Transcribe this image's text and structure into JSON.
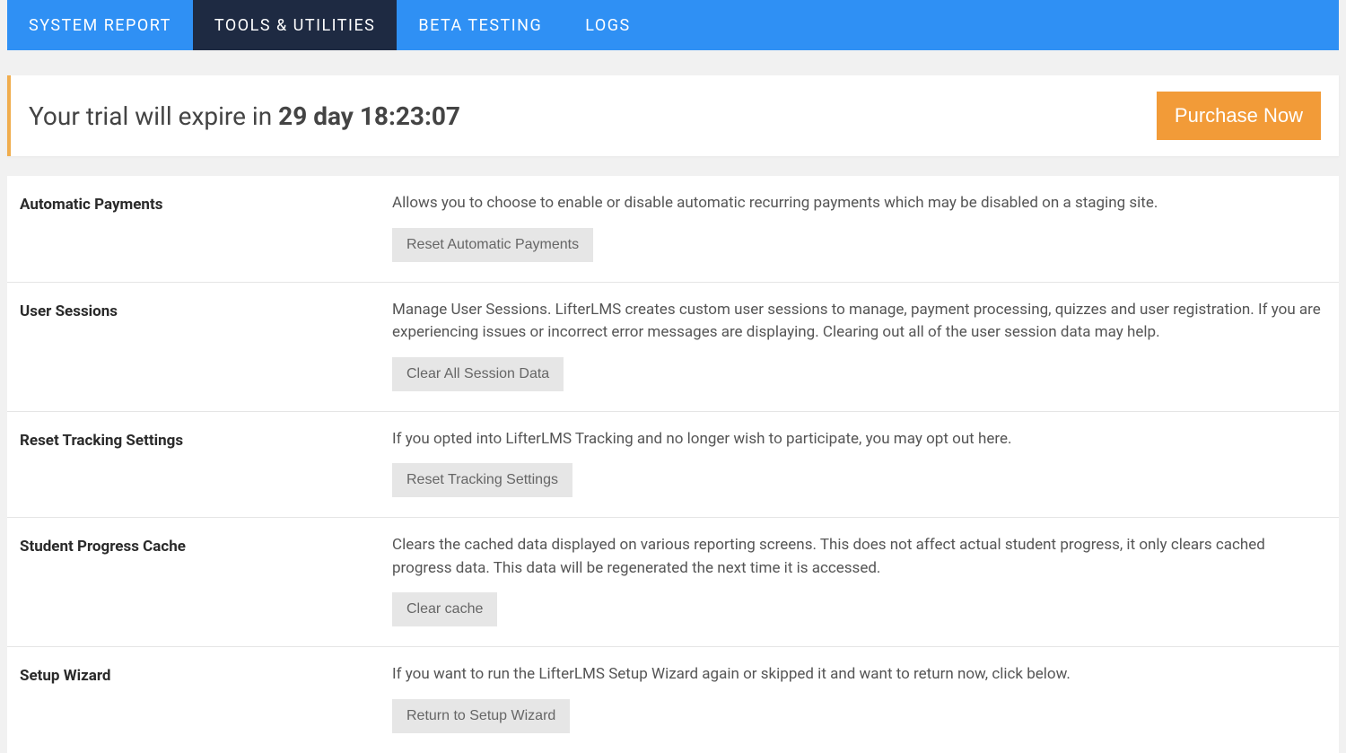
{
  "nav": {
    "tabs": [
      {
        "label": "SYSTEM REPORT",
        "active": false
      },
      {
        "label": "TOOLS & UTILITIES",
        "active": true
      },
      {
        "label": "BETA TESTING",
        "active": false
      },
      {
        "label": "LOGS",
        "active": false
      }
    ]
  },
  "trial": {
    "prefix": "Your trial will expire in ",
    "remaining": "29 day 18:23:07",
    "button_label": "Purchase Now"
  },
  "tools": [
    {
      "title": "Automatic Payments",
      "description": "Allows you to choose to enable or disable automatic recurring payments which may be disabled on a staging site.",
      "button_label": "Reset Automatic Payments"
    },
    {
      "title": "User Sessions",
      "description": "Manage User Sessions. LifterLMS creates custom user sessions to manage, payment processing, quizzes and user registration. If you are experiencing issues or incorrect error messages are displaying. Clearing out all of the user session data may help.",
      "button_label": "Clear All Session Data"
    },
    {
      "title": "Reset Tracking Settings",
      "description": "If you opted into LifterLMS Tracking and no longer wish to participate, you may opt out here.",
      "button_label": "Reset Tracking Settings"
    },
    {
      "title": "Student Progress Cache",
      "description": "Clears the cached data displayed on various reporting screens. This does not affect actual student progress, it only clears cached progress data. This data will be regenerated the next time it is accessed.",
      "button_label": "Clear cache"
    },
    {
      "title": "Setup Wizard",
      "description": "If you want to run the LifterLMS Setup Wizard again or skipped it and want to return now, click below.",
      "button_label": "Return to Setup Wizard"
    }
  ]
}
